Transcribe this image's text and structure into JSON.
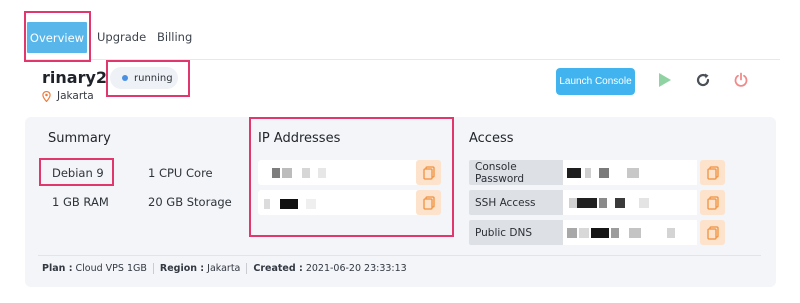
{
  "tabs": [
    {
      "label": "Overview",
      "active": true
    },
    {
      "label": "Upgrade",
      "active": false
    },
    {
      "label": "Billing",
      "active": false
    }
  ],
  "server": {
    "name": "rinary2",
    "location": "Jakarta",
    "status": "running"
  },
  "actions": {
    "launch_console": "Launch Console",
    "start_icon": "play-icon",
    "restart_icon": "restart-icon",
    "power_icon": "power-icon"
  },
  "summary": {
    "title": "Summary",
    "os": "Debian 9",
    "cpu": "1 CPU Core",
    "ram": "1 GB RAM",
    "storage": "20 GB Storage"
  },
  "ip_addresses": {
    "title": "IP Addresses"
  },
  "access": {
    "title": "Access",
    "items": [
      {
        "label": "Console Password"
      },
      {
        "label": "SSH Access"
      },
      {
        "label": "Public DNS"
      }
    ]
  },
  "footer": {
    "plan_label": "Plan :",
    "plan_value": "Cloud VPS 1GB",
    "region_label": "Region :",
    "region_value": "Jakarta",
    "created_label": "Created :",
    "created_value": "2021-06-20 23:33:13"
  },
  "colors": {
    "accent": "#41b4f0",
    "highlight": "#e0386d",
    "play": "#8fd3a3",
    "power": "#f08a8a",
    "copy_bg": "#fde3cc",
    "copy_icon": "#f0923f"
  }
}
